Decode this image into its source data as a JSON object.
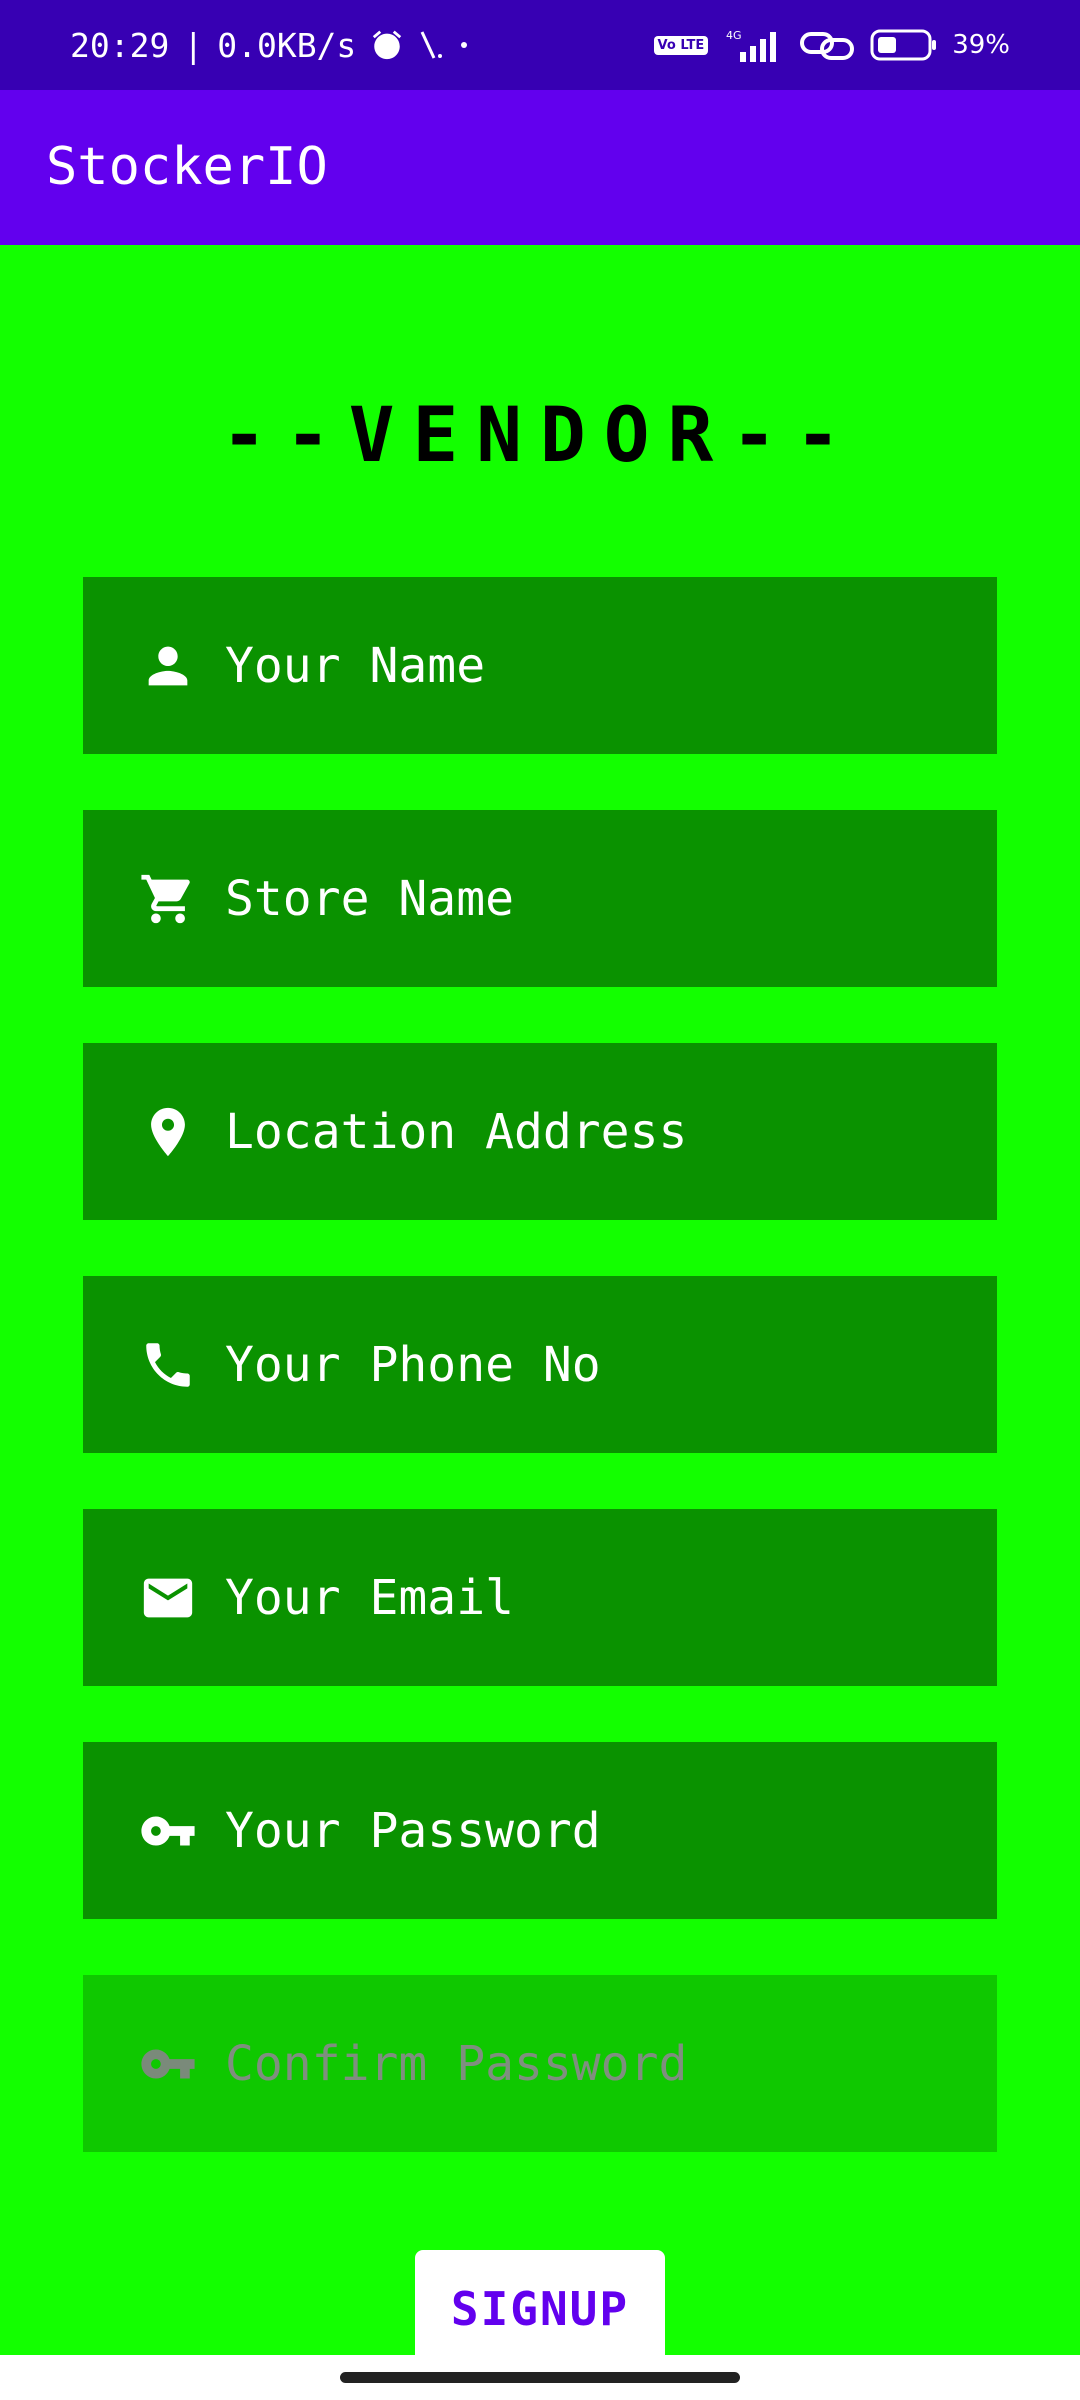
{
  "status_bar": {
    "time": "20:29",
    "separator": "|",
    "net_speed": "0.0KB/s",
    "volte": "Vo LTE",
    "network": "4G",
    "battery_percent": "39%",
    "icons": [
      "alarm-icon",
      "signal-icon",
      "link-icon",
      "battery-icon"
    ]
  },
  "app_bar": {
    "title": "StockerIO"
  },
  "screen": {
    "title": "--VENDOR--"
  },
  "form": {
    "fields": [
      {
        "placeholder": "Your Name",
        "icon": "person-icon"
      },
      {
        "placeholder": "Store Name",
        "icon": "cart-icon"
      },
      {
        "placeholder": "Location Address",
        "icon": "location-pin-icon"
      },
      {
        "placeholder": "Your Phone No",
        "icon": "phone-icon"
      },
      {
        "placeholder": "Your Email",
        "icon": "email-icon"
      },
      {
        "placeholder": "Your Password",
        "icon": "key-icon"
      },
      {
        "placeholder": "Confirm Password",
        "icon": "key-icon",
        "enabled": false
      }
    ],
    "signup_label": "SIGNUP"
  },
  "colors": {
    "status_bar": "#3700b3",
    "app_bar": "#6200ee",
    "background": "#13ff00",
    "field": "#0a9200",
    "field_disabled": "#0fc800",
    "accent": "#6200ee"
  }
}
